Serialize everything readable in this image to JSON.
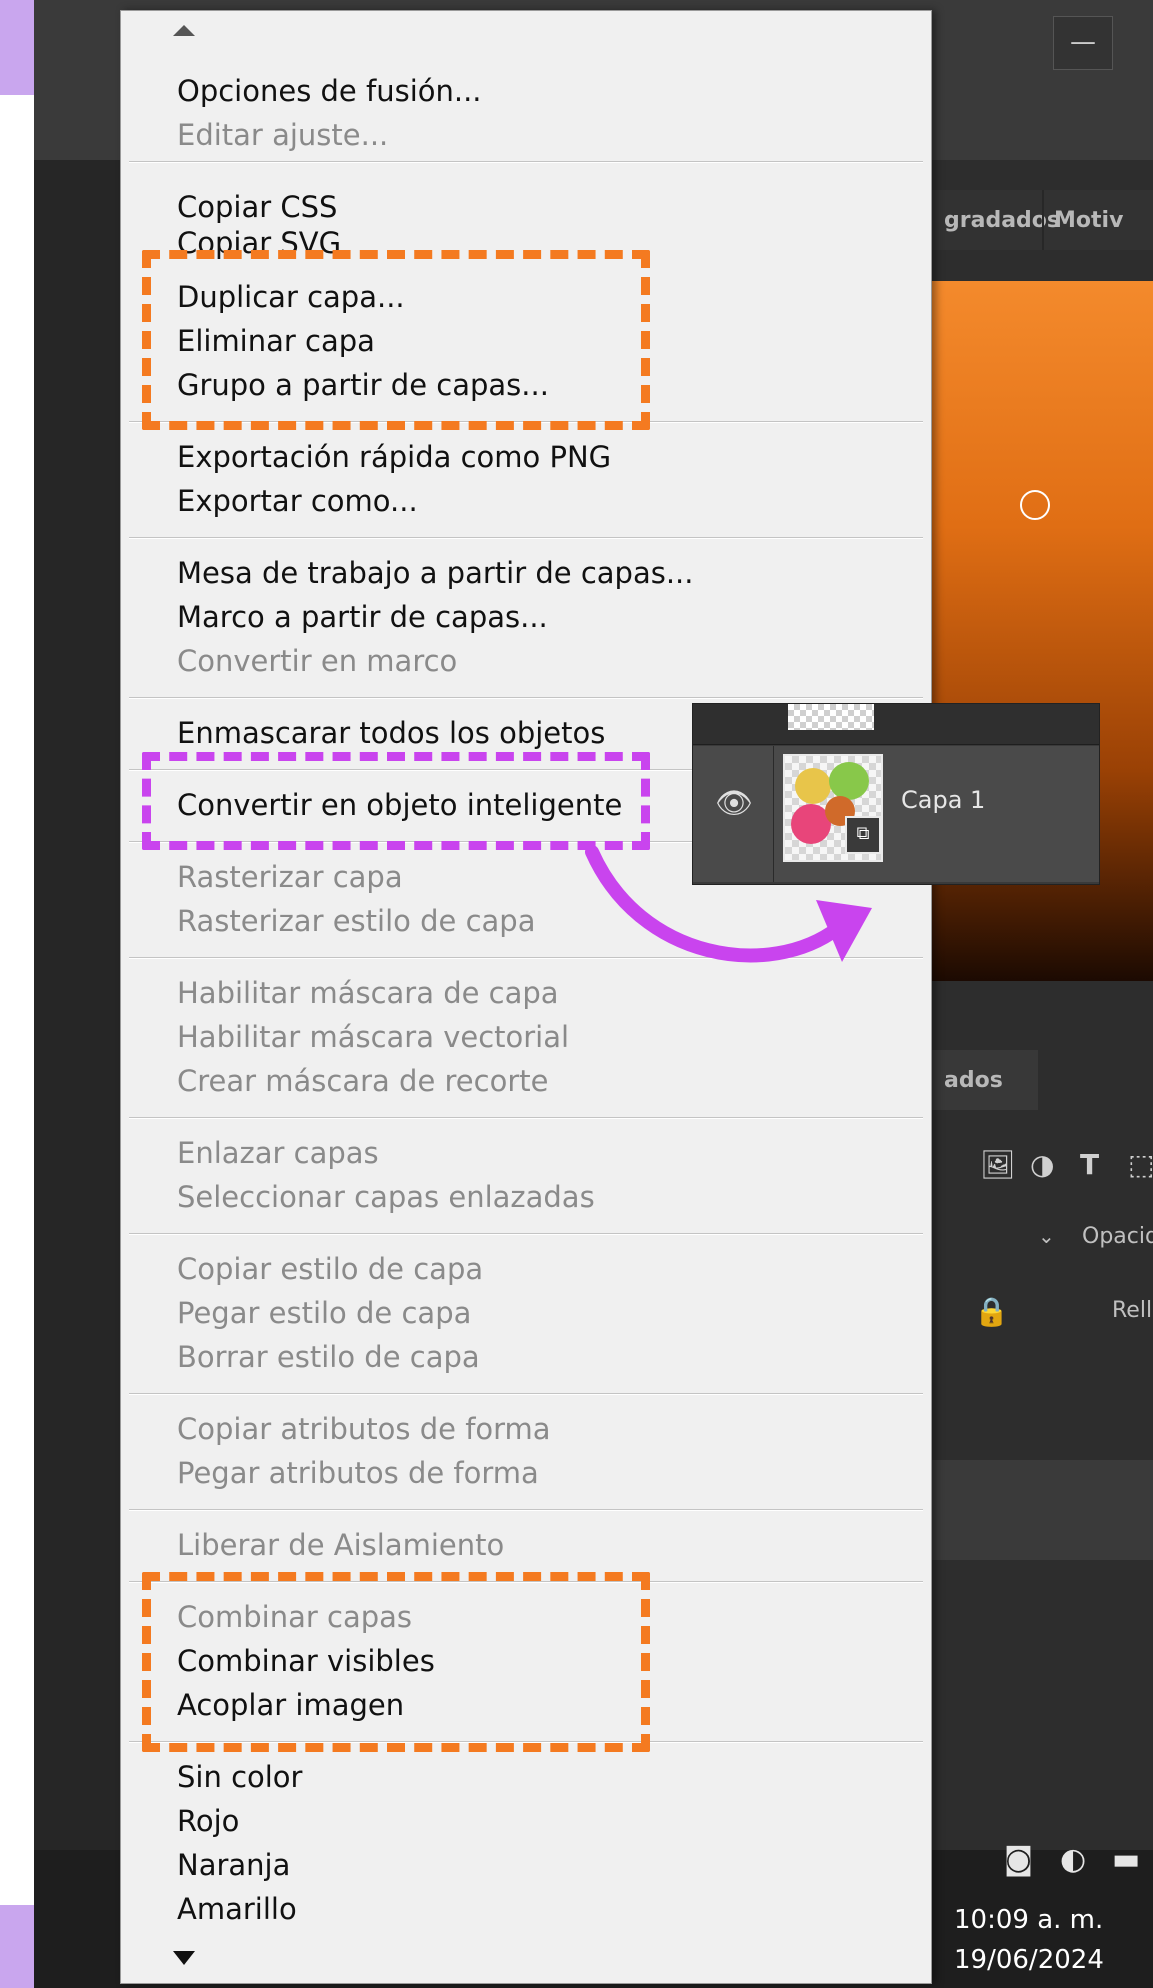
{
  "window": {
    "minimize_glyph": "—"
  },
  "right_panel": {
    "tabs": [
      "gradados",
      "Motiv"
    ],
    "section_tab": "ados",
    "opacity_label": "Opacidad",
    "fill_label": "Relleno",
    "panel_icons": [
      "image-icon",
      "adjustment-icon",
      "type-icon",
      "shape-icon"
    ],
    "bottom_icons": [
      "mask-icon",
      "adjustment-layer-icon",
      "folder-icon"
    ]
  },
  "taskbar": {
    "time": "10:09 a. m.",
    "date": "19/06/2024"
  },
  "menu": {
    "items": [
      {
        "label": "Opciones de fusión...",
        "enabled": true
      },
      {
        "label": "Editar ajuste...",
        "enabled": false
      },
      {
        "label": "Copiar CSS",
        "enabled": true
      },
      {
        "label": "Copiar SVG",
        "enabled": true
      },
      {
        "label": "Duplicar capa...",
        "enabled": true
      },
      {
        "label": "Eliminar capa",
        "enabled": true
      },
      {
        "label": "Grupo a partir de capas...",
        "enabled": true
      },
      {
        "label": "Exportación rápida como PNG",
        "enabled": true
      },
      {
        "label": "Exportar como...",
        "enabled": true
      },
      {
        "label": "Mesa de trabajo a partir de capas...",
        "enabled": true
      },
      {
        "label": "Marco a partir de capas...",
        "enabled": true
      },
      {
        "label": "Convertir en marco",
        "enabled": false
      },
      {
        "label": "Enmascarar todos los objetos",
        "enabled": true
      },
      {
        "label": "Convertir en objeto inteligente",
        "enabled": true
      },
      {
        "label": "Rasterizar capa",
        "enabled": false
      },
      {
        "label": "Rasterizar estilo de capa",
        "enabled": false
      },
      {
        "label": "Habilitar máscara de capa",
        "enabled": false
      },
      {
        "label": "Habilitar máscara vectorial",
        "enabled": false
      },
      {
        "label": "Crear máscara de recorte",
        "enabled": false
      },
      {
        "label": "Enlazar capas",
        "enabled": false
      },
      {
        "label": "Seleccionar capas enlazadas",
        "enabled": false
      },
      {
        "label": "Copiar estilo de capa",
        "enabled": false
      },
      {
        "label": "Pegar estilo de capa",
        "enabled": false
      },
      {
        "label": "Borrar estilo de capa",
        "enabled": false
      },
      {
        "label": "Copiar atributos de forma",
        "enabled": false
      },
      {
        "label": "Pegar atributos de forma",
        "enabled": false
      },
      {
        "label": "Liberar de Aislamiento",
        "enabled": false
      },
      {
        "label": "Combinar capas",
        "enabled": false
      },
      {
        "label": "Combinar visibles",
        "enabled": true
      },
      {
        "label": "Acoplar imagen",
        "enabled": true
      },
      {
        "label": "Sin color",
        "enabled": true
      },
      {
        "label": "Rojo",
        "enabled": true
      },
      {
        "label": "Naranja",
        "enabled": true
      },
      {
        "label": "Amarillo",
        "enabled": true
      }
    ]
  },
  "layer_preview": {
    "name": "Capa 1",
    "badge": "smart-object-badge"
  },
  "colors": {
    "highlight_orange": "#f47a20",
    "highlight_purple": "#c944ee",
    "menu_bg": "#f0f0f0"
  }
}
